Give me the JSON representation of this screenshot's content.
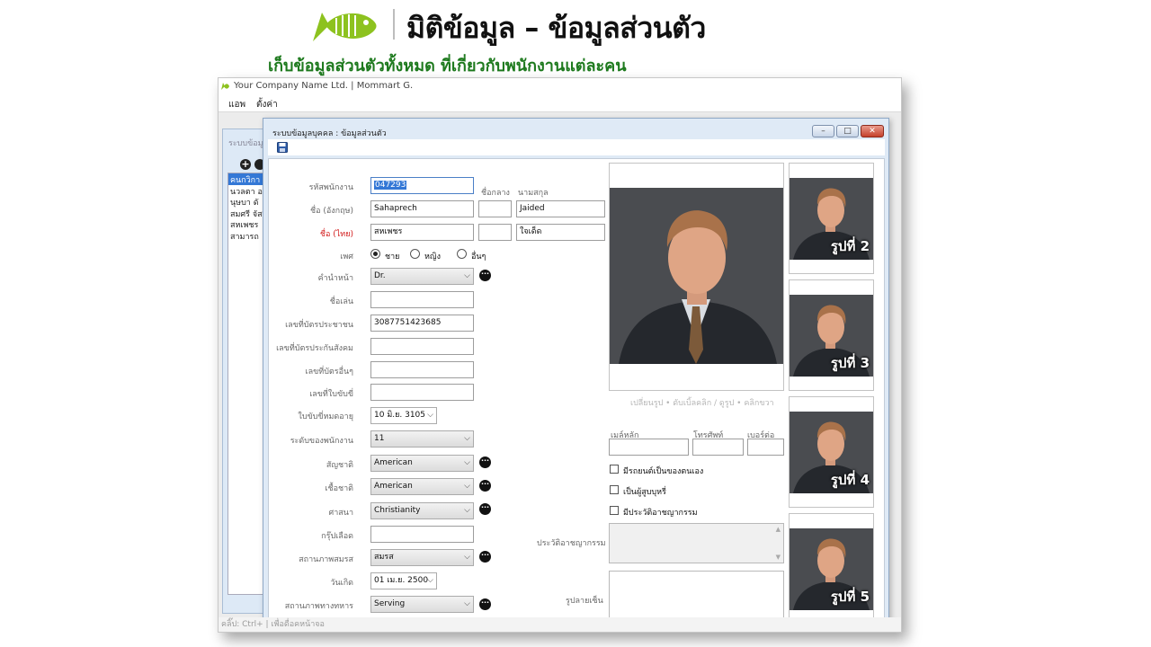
{
  "header": {
    "title": "มิติข้อมูล – ข้อมูลส่วนตัว",
    "subtitle": "เก็บข้อมูลส่วนตัวทั้งหมด ที่เกี่ยวกับพนักงานแต่ละคน",
    "brand_color": "#8dc21f"
  },
  "app": {
    "title": "Your Company Name Ltd. | Mommart G.",
    "menu": [
      "แอพ",
      "ตั้งค่า"
    ],
    "status": "คลิ๊ป: Ctrl+ | เพื่อดื่อคหน้าจอ"
  },
  "bgwin": {
    "title": "ระบบข้อมู",
    "list": [
      "คนกวิกา",
      "นวลตา อ",
      "นุษบา ดั",
      "สมศรี จัส",
      "สหเพชร",
      "สามารถ"
    ]
  },
  "dialog": {
    "title": "ระบบข้อมูลบุคคล : ข้อมูลส่วนตัว",
    "buttons": {
      "minimize": "–",
      "maximize": "□",
      "close": "✕"
    }
  },
  "form": {
    "emp_id_label": "รหัสพนักงาน",
    "emp_id": "047293",
    "middle_name_label": "ชื่อกลาง",
    "surname_label": "นามสกุล",
    "name_en_label": "ชื่อ (อังกฤษ)",
    "first_en": "Sahaprech",
    "middle_en": "",
    "last_en": "Jaided",
    "name_th_label": "ชื่อ (ไทย)",
    "first_th": "สหเพชร",
    "middle_th": "",
    "last_th": "ใจเด็ด",
    "gender_label": "เพศ",
    "gender_options": [
      "ชาย",
      "หญิง",
      "อื่นๆ"
    ],
    "gender_selected": 0,
    "prefix_label": "คำนำหน้า",
    "prefix": "Dr.",
    "nickname_label": "ชื่อเล่น",
    "nickname": "",
    "id_card_label": "เลขที่บัตรประชาชน",
    "id_card": "3087751423685",
    "social_sec_label": "เลขที่บัตรประกันสังคม",
    "social_sec": "",
    "other_card_label": "เลขที่บัตรอื่นๆ",
    "other_card": "",
    "license_label": "เลขที่ใบขับขี่",
    "license": "",
    "license_exp_label": "ใบขับขี่หมดอายุ",
    "license_exp": "10 มิ.ย.  3105",
    "level_label": "ระดับของพนักงาน",
    "level": "11",
    "nationality_label": "สัญชาติ",
    "nationality": "American",
    "race_label": "เชื้อชาติ",
    "race": "American",
    "religion_label": "ศาสนา",
    "religion": "Christianity",
    "blood_label": "กรุ๊ปเลือด",
    "blood": "",
    "marital_label": "สถานภาพสมรส",
    "marital": "สมรส",
    "birth_label": "วันเกิด",
    "birth": "01 เม.ย.  2500",
    "military_label": "สถานภาพทางทหาร",
    "military": "Serving"
  },
  "photos": {
    "main_hint": "เปลี่ยนรูป • ดับเบิ้ลคลิก / ดูรูป • คลิกขวา",
    "thumbs": [
      "รูปที่ 2",
      "รูปที่ 3",
      "รูปที่ 4",
      "รูปที่ 5"
    ]
  },
  "contact": {
    "email_label": "เมล์หลัก",
    "phone_label": "โทรศัพท์",
    "ext_label": "เบอร์ต่อ",
    "checks": [
      "มีรถยนต์เป็นของตนเอง",
      "เป็นผู้สูบบุหรี่",
      "มีประวัติอาชญากรรม"
    ],
    "criminal_label": "ประวัติอาชญากรรม",
    "signature_label": "รูปลายเซ็น"
  }
}
